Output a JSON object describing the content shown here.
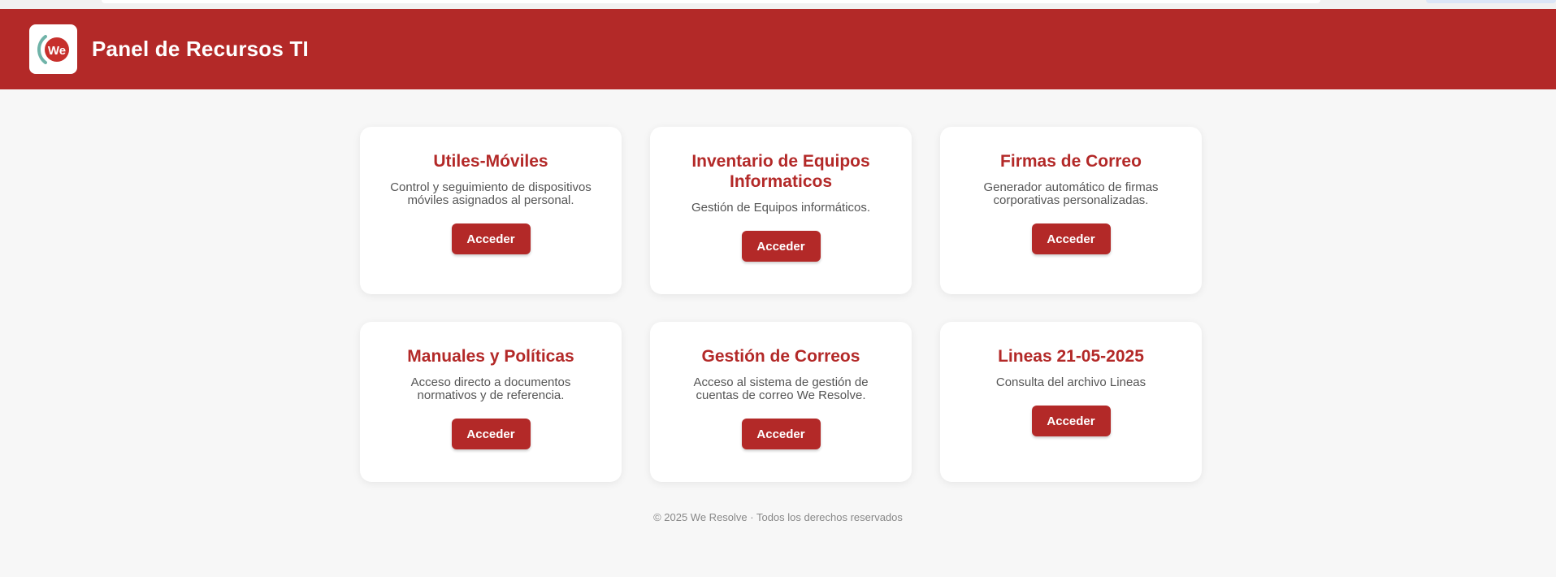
{
  "header": {
    "title": "Panel de Recursos TI",
    "logo_text": "We",
    "brand_color": "#b32928"
  },
  "cards": [
    {
      "title": "Utiles-Móviles",
      "description": "Control y seguimiento de dispositivos móviles asignados al personal.",
      "button": "Acceder"
    },
    {
      "title": "Inventario de Equipos Informaticos",
      "description": "Gestión de Equipos informáticos.",
      "button": "Acceder"
    },
    {
      "title": "Firmas de Correo",
      "description": "Generador automático de firmas corporativas personalizadas.",
      "button": "Acceder"
    },
    {
      "title": "Manuales y Políticas",
      "description": "Acceso directo a documentos normativos y de referencia.",
      "button": "Acceder"
    },
    {
      "title": "Gestión de Correos",
      "description": "Acceso al sistema de gestión de cuentas de correo We Resolve.",
      "button": "Acceder"
    },
    {
      "title": "Lineas 21-05-2025",
      "description": "Consulta del archivo Lineas",
      "button": "Acceder"
    }
  ],
  "footer": {
    "text": "© 2025 We Resolve · Todos los derechos reservados"
  }
}
